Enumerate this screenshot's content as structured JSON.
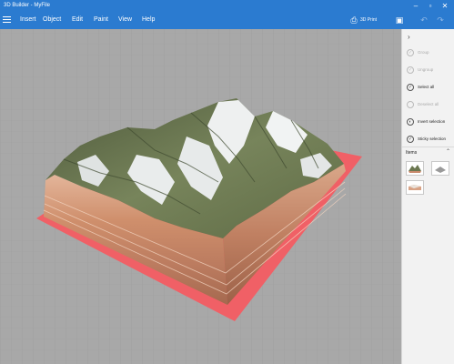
{
  "window": {
    "title": "3D Builder - MyFile"
  },
  "menu": {
    "items": [
      "Insert",
      "Object",
      "Edit",
      "Paint",
      "View",
      "Help"
    ]
  },
  "toolbar": {
    "print_label": "3D Print"
  },
  "sidebar": {
    "commands": [
      {
        "label": "Group",
        "enabled": false
      },
      {
        "label": "Ungroup",
        "enabled": false
      },
      {
        "label": "Select all",
        "enabled": true
      },
      {
        "label": "Deselect all",
        "enabled": false
      },
      {
        "label": "Invert selection",
        "enabled": true
      },
      {
        "label": "Sticky selection",
        "enabled": true
      }
    ],
    "items_title": "Items"
  },
  "icons": {
    "menu": "hamburger-icon",
    "print": "3d-print-icon",
    "save": "save-icon",
    "undo": "undo-icon",
    "redo": "redo-icon",
    "minimize": "minimize-icon",
    "maximize": "maximize-icon",
    "close": "close-icon",
    "collapse": "chevron-right-icon",
    "items_toggle": "chevron-up-icon"
  },
  "colors": {
    "accent": "#2b7bd0",
    "viewport": "#a8a8a8",
    "base_plate": "#f06066",
    "soil": "#c98a6c",
    "rock": "#6f7a4f",
    "snow": "#eef0f0"
  }
}
